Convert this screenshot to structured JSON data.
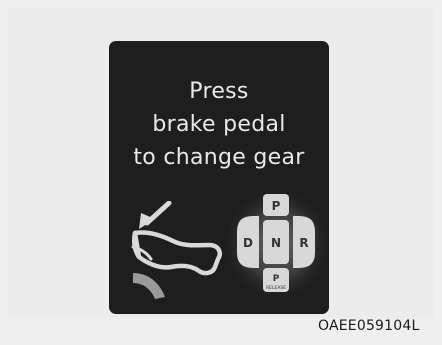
{
  "display": {
    "line1": "Press",
    "line2": "brake pedal",
    "line3": "to change gear"
  },
  "icons": {
    "foot": "foot-on-brake-pedal-icon",
    "arrow": "press-arrow-icon",
    "shifter": "gear-shift-buttons-icon"
  },
  "gear_buttons": {
    "p_top": "P",
    "d": "D",
    "n": "N",
    "r": "R",
    "p_bottom": "P",
    "release": "RELEASE"
  },
  "caption": "OAEE059104L",
  "colors": {
    "background": "#efefef",
    "display": "#1e1e1e",
    "text": "#e9e9e9",
    "button": "#d8d8d8"
  }
}
